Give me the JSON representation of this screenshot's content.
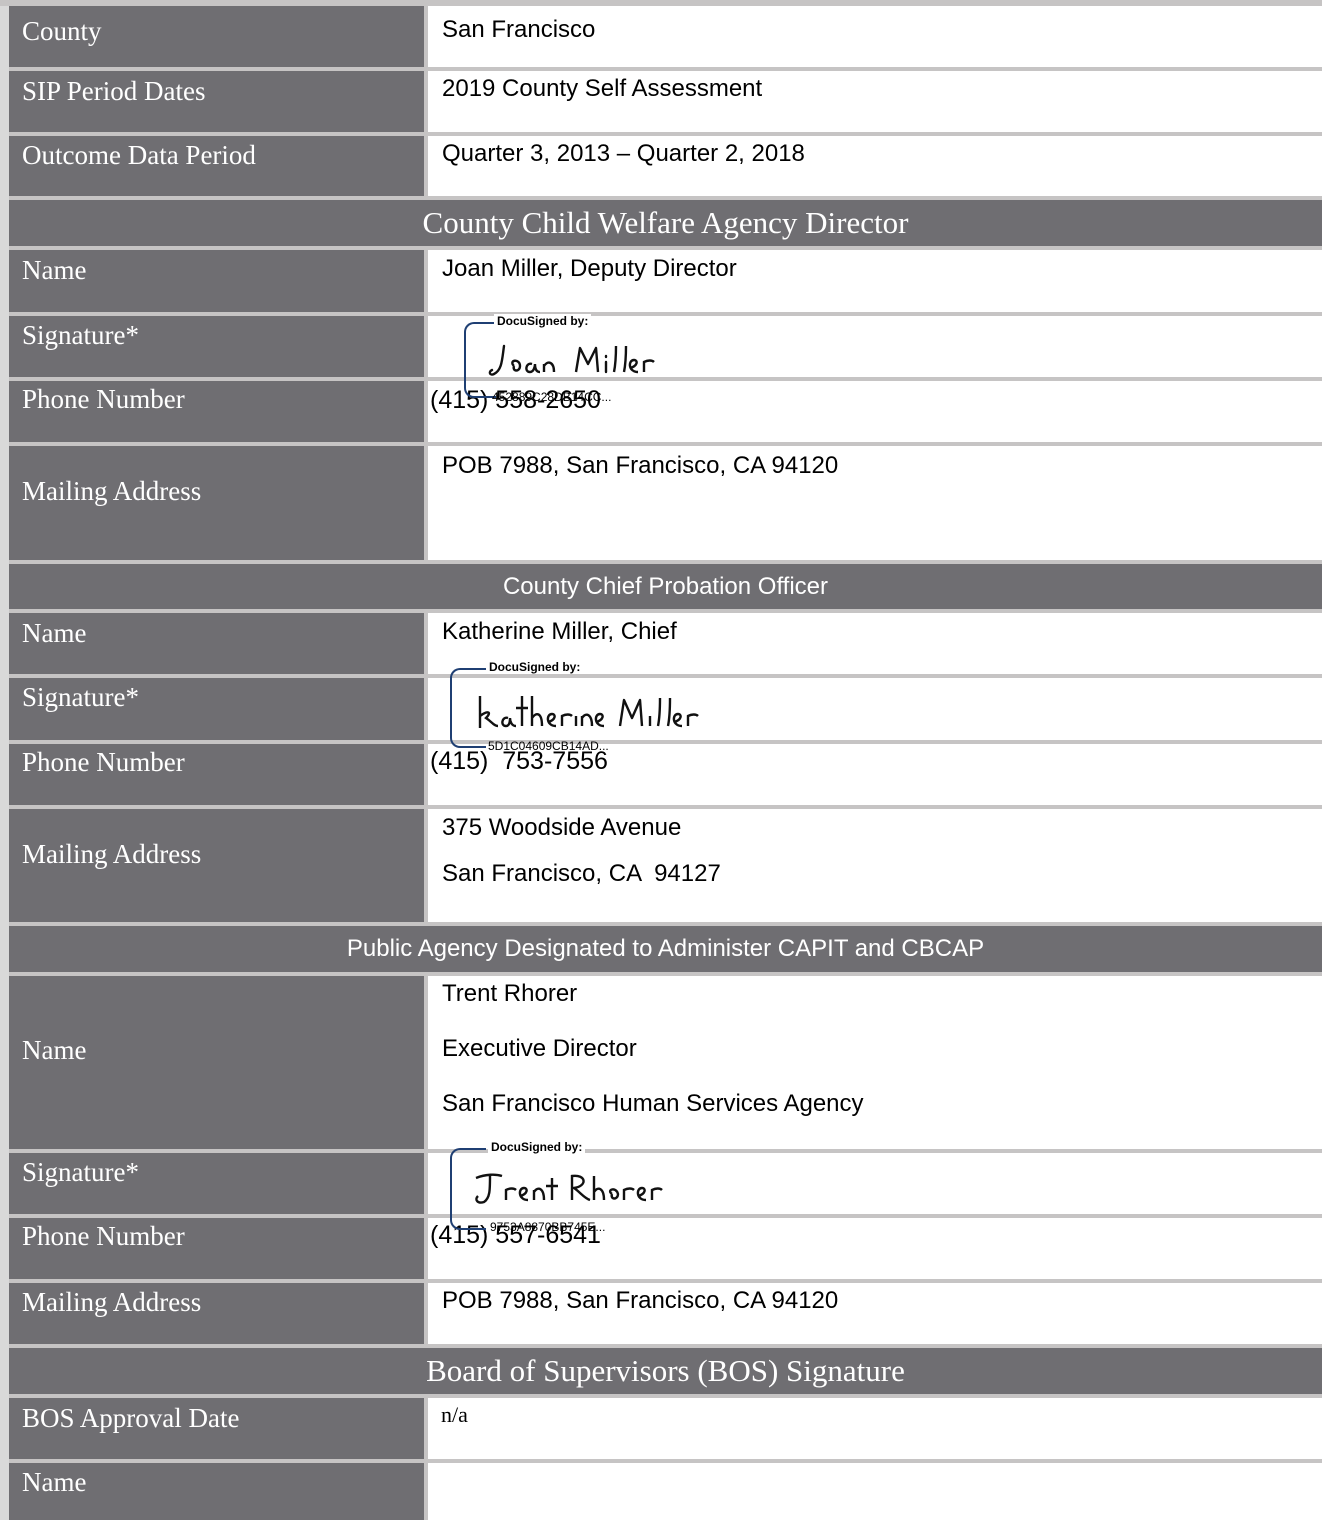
{
  "county": {
    "label": "County",
    "value": "San Francisco"
  },
  "sip_period": {
    "label": "SIP Period Dates",
    "value": "2019 County Self Assessment"
  },
  "outcome_period": {
    "label": "Outcome Data Period",
    "value": "Quarter 3, 2013 – Quarter 2, 2018"
  },
  "child_welfare": {
    "header": "County Child Welfare Agency Director",
    "name_label": "Name",
    "name": "Joan Miller, Deputy Director",
    "signature_label": "Signature*",
    "docusign_label": "DocuSigned by:",
    "signature_text": "Joan Miller",
    "docusign_id": "452889C28DB14CC...",
    "phone_label": "Phone Number",
    "phone": "(415) 558-2650",
    "address_label": "Mailing Address",
    "address": "POB 7988, San Francisco, CA  94120"
  },
  "probation": {
    "header": "County Chief Probation Officer",
    "name_label": "Name",
    "name": "Katherine Miller, Chief",
    "signature_label": "Signature*",
    "docusign_label": "DocuSigned by:",
    "signature_text": "katherine Miller",
    "docusign_id": "5D1C04609CB14AD...",
    "phone_label": "Phone Number",
    "phone": "(415)  753-7556",
    "address_label": "Mailing Address",
    "address_line1": "375 Woodside Avenue",
    "address_line2": "San Francisco, CA  94127"
  },
  "public_agency": {
    "header": "Public Agency Designated to Administer CAPIT and CBCAP",
    "name_label": "Name",
    "name_line1": "Trent Rhorer",
    "name_line2": "Executive Director",
    "name_line3": "San Francisco Human Services Agency",
    "signature_label": "Signature*",
    "docusign_label": "DocuSigned by:",
    "signature_text": "Trent Rhorer",
    "docusign_id": "9753A8870BB745E...",
    "phone_label": "Phone Number",
    "phone": "(415) 557-6541",
    "address_label": "Mailing Address",
    "address": "POB 7988, San Francisco, CA  94120"
  },
  "bos": {
    "header": "Board of Supervisors (BOS) Signature",
    "approval_label": "BOS Approval Date",
    "approval_value": "n/a",
    "name_label": "Name",
    "name": ""
  },
  "colors": {
    "label_bg": "#6f6e72",
    "separator": "#c6c4c4",
    "signature_ink": "#1f3f73"
  }
}
